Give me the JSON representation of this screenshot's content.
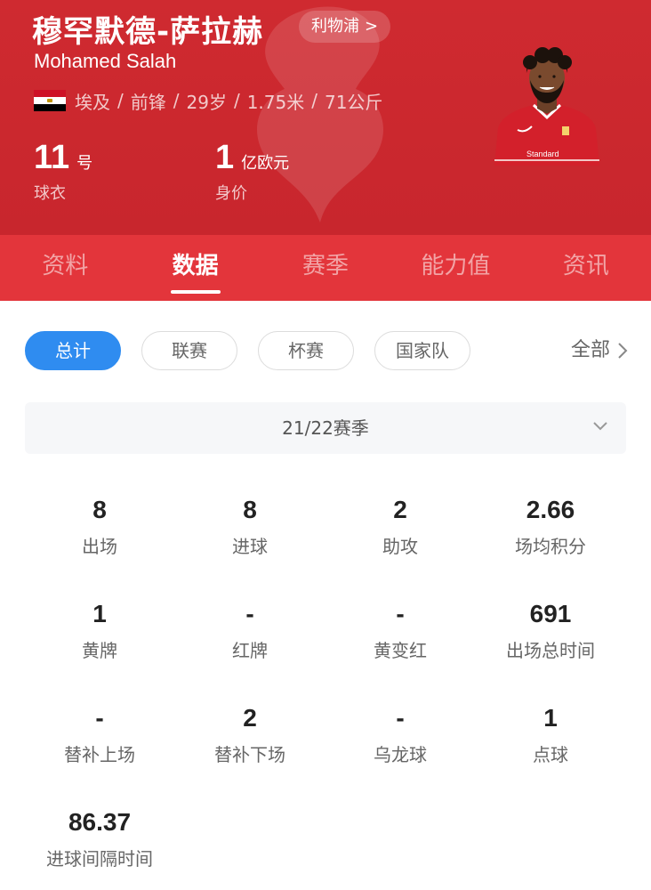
{
  "player": {
    "name_cn": "穆罕默德-萨拉赫",
    "name_en": "Mohamed Salah",
    "club": "利物浦",
    "club_chevron": ">",
    "nation": "埃及",
    "position": "前锋",
    "age": "29岁",
    "height": "1.75米",
    "weight": "71公斤",
    "separator": "/",
    "jersey_number": "11",
    "jersey_unit": "号",
    "jersey_caption": "球衣",
    "value_number": "1",
    "value_unit": "亿欧元",
    "value_caption": "身价",
    "kit_sponsor": "Standard"
  },
  "tabs": [
    "资料",
    "数据",
    "赛季",
    "能力值",
    "资讯"
  ],
  "filters": {
    "chips": [
      "总计",
      "联赛",
      "杯赛",
      "国家队"
    ],
    "all_label": "全部"
  },
  "season": {
    "selected": "21/22赛季"
  },
  "stats": [
    {
      "value": "8",
      "label": "出场"
    },
    {
      "value": "8",
      "label": "进球"
    },
    {
      "value": "2",
      "label": "助攻"
    },
    {
      "value": "2.66",
      "label": "场均积分"
    },
    {
      "value": "1",
      "label": "黄牌"
    },
    {
      "value": "-",
      "label": "红牌"
    },
    {
      "value": "-",
      "label": "黄变红"
    },
    {
      "value": "691",
      "label": "出场总时间"
    },
    {
      "value": "-",
      "label": "替补上场"
    },
    {
      "value": "2",
      "label": "替补下场"
    },
    {
      "value": "-",
      "label": "乌龙球"
    },
    {
      "value": "1",
      "label": "点球"
    },
    {
      "value": "86.37",
      "label": "进球间隔时间"
    }
  ],
  "colors": {
    "header_bg": "#cf2a30",
    "tabs_bg": "#e3353b",
    "active_chip": "#2f8cf0"
  }
}
